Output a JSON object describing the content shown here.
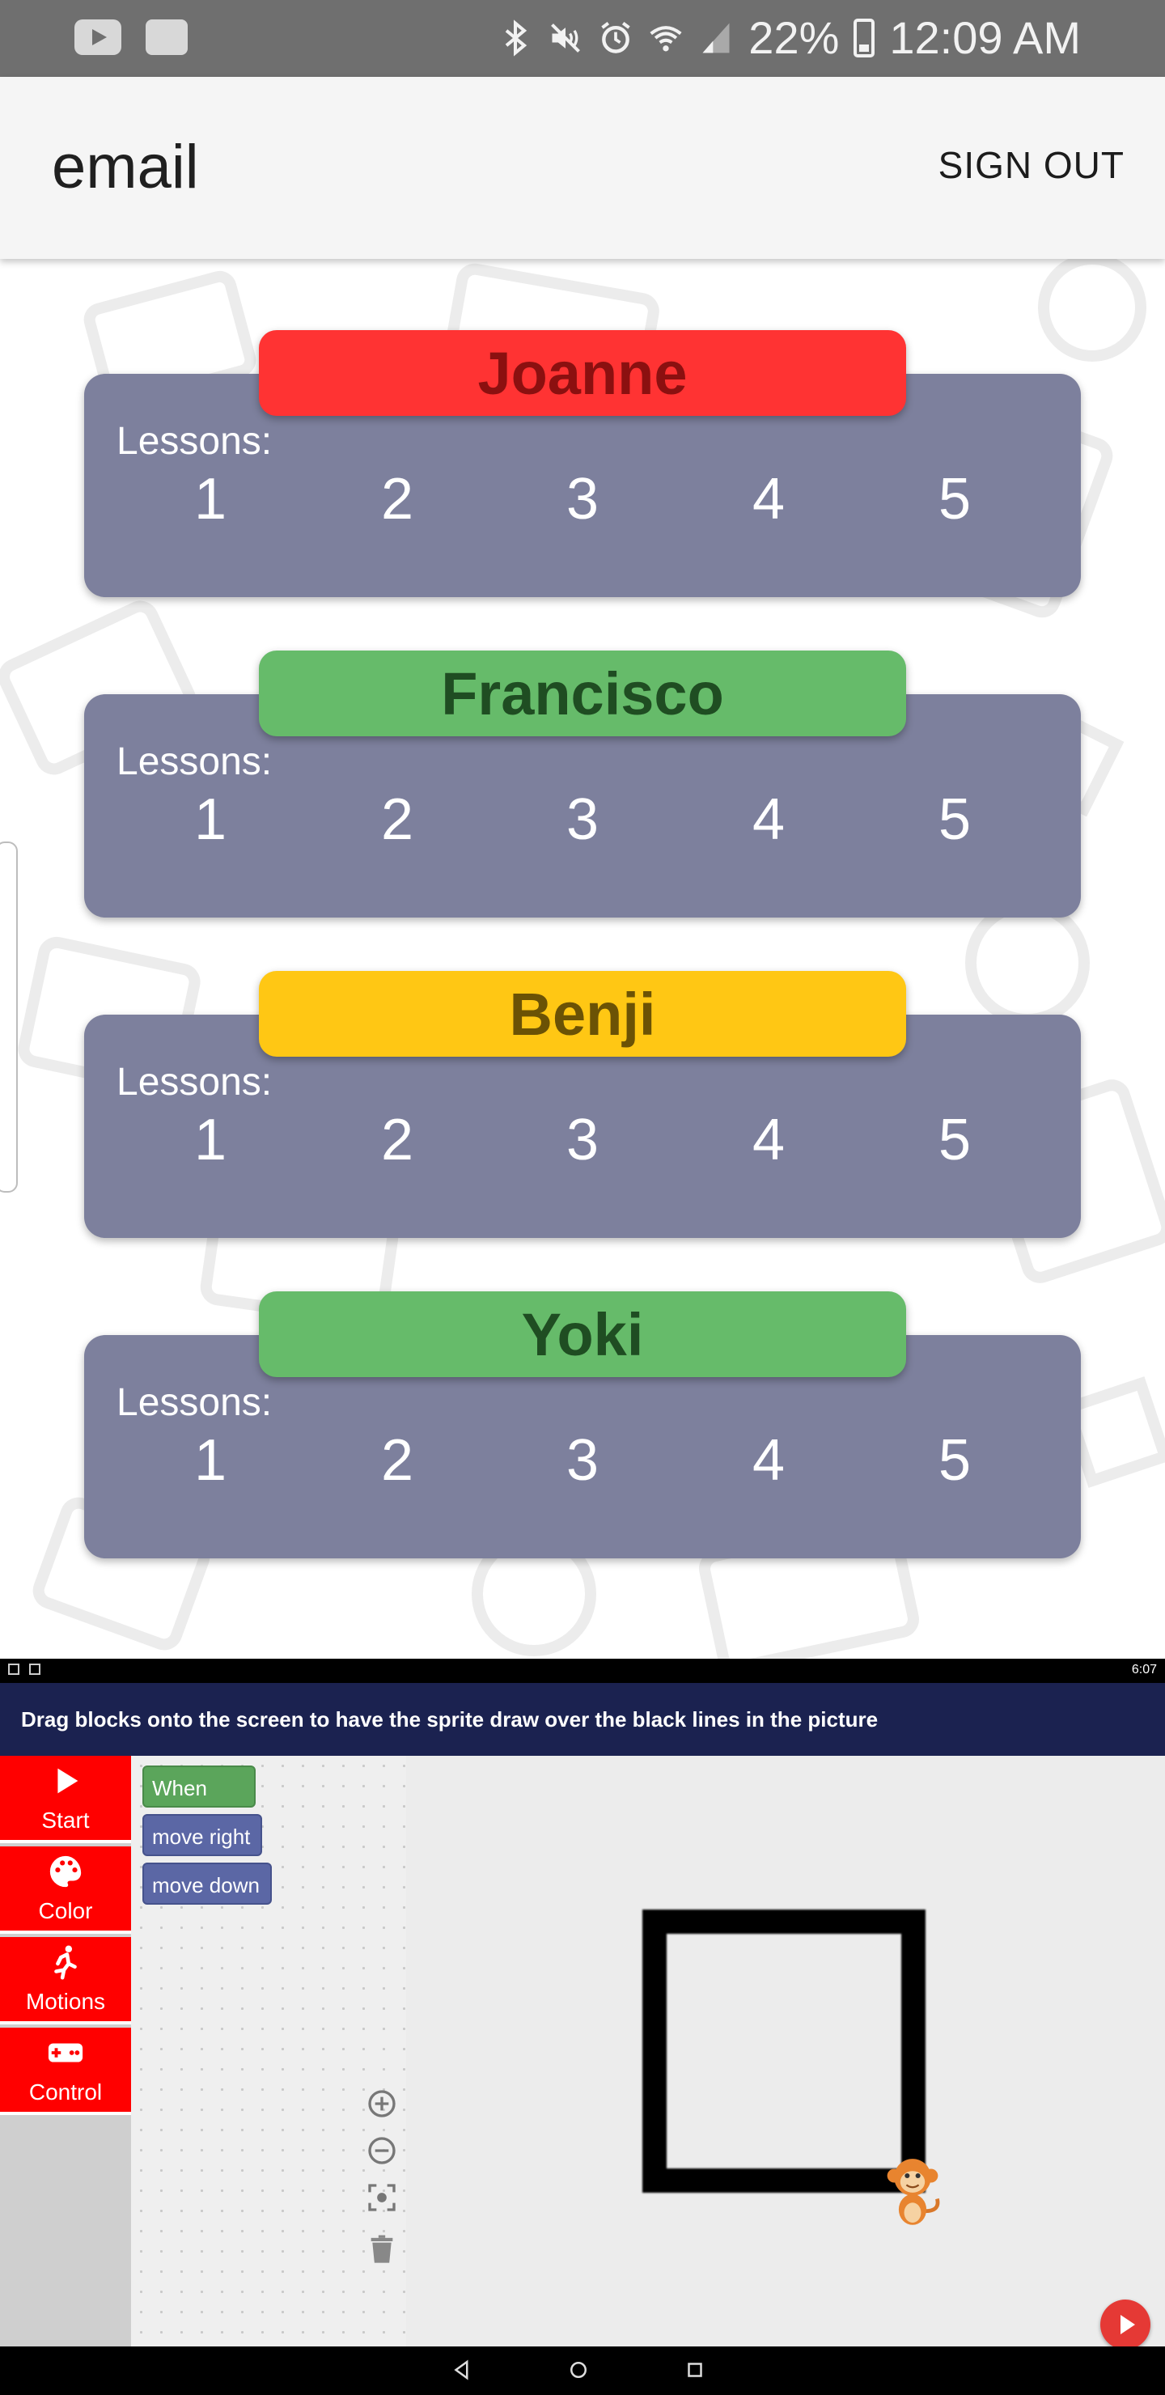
{
  "status_bar": {
    "battery": "22%",
    "time": "12:09 AM"
  },
  "app_bar": {
    "title": "email",
    "sign_out": "SIGN OUT"
  },
  "students": [
    {
      "name": "Joanne",
      "color": "#ff3333",
      "text_color": "#8b1010",
      "lessons_label": "Lessons:",
      "lessons": [
        "1",
        "2",
        "3",
        "4",
        "5"
      ]
    },
    {
      "name": "Francisco",
      "color": "#66bb6a",
      "text_color": "#1f4d22",
      "lessons_label": "Lessons:",
      "lessons": [
        "1",
        "2",
        "3",
        "4",
        "5"
      ]
    },
    {
      "name": "Benji",
      "color": "#ffc714",
      "text_color": "#6b5205",
      "lessons_label": "Lessons:",
      "lessons": [
        "1",
        "2",
        "3",
        "4",
        "5"
      ]
    },
    {
      "name": "Yoki",
      "color": "#66bb6a",
      "text_color": "#1f4d22",
      "lessons_label": "Lessons:",
      "lessons": [
        "1",
        "2",
        "3",
        "4",
        "5"
      ]
    }
  ],
  "embedded_app": {
    "status_time": "6:07",
    "instruction": "Drag blocks onto the screen to have the sprite draw over the black lines in the picture",
    "categories": [
      {
        "label": "Start",
        "icon": "play-icon"
      },
      {
        "label": "Color",
        "icon": "palette-icon"
      },
      {
        "label": "Motions",
        "icon": "running-person-icon"
      },
      {
        "label": "Control",
        "icon": "gamepad-icon"
      }
    ],
    "blocks": [
      {
        "label": "When Run",
        "kind": "event"
      },
      {
        "label": "move right",
        "kind": "motion"
      },
      {
        "label": "move down",
        "kind": "motion"
      }
    ],
    "workspace_controls": [
      "zoom-in-icon",
      "zoom-out-icon",
      "recenter-icon",
      "trash-icon"
    ]
  }
}
